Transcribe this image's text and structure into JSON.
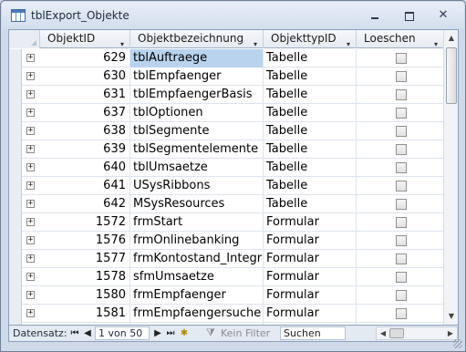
{
  "window": {
    "title": "tblExport_Objekte",
    "buttons": {
      "minimize": "",
      "maximize": "",
      "close": "✕"
    }
  },
  "columns": {
    "objektid": "ObjektID",
    "bezeichnung": "Objektbezeichnung",
    "typ": "ObjekttypID",
    "loeschen": "Loeschen",
    "sort_arrow": "▾"
  },
  "rows": [
    {
      "id": "629",
      "name": "tblAuftraege",
      "type": "Tabelle",
      "loeschen": false
    },
    {
      "id": "630",
      "name": "tblEmpfaenger",
      "type": "Tabelle",
      "loeschen": false
    },
    {
      "id": "631",
      "name": "tblEmpfaengerBasis",
      "type": "Tabelle",
      "loeschen": false
    },
    {
      "id": "637",
      "name": "tblOptionen",
      "type": "Tabelle",
      "loeschen": false
    },
    {
      "id": "638",
      "name": "tblSegmente",
      "type": "Tabelle",
      "loeschen": false
    },
    {
      "id": "639",
      "name": "tblSegmentelemente",
      "type": "Tabelle",
      "loeschen": false
    },
    {
      "id": "640",
      "name": "tblUmsaetze",
      "type": "Tabelle",
      "loeschen": false
    },
    {
      "id": "641",
      "name": "USysRibbons",
      "type": "Tabelle",
      "loeschen": false
    },
    {
      "id": "642",
      "name": "MSysResources",
      "type": "Tabelle",
      "loeschen": false
    },
    {
      "id": "1572",
      "name": "frmStart",
      "type": "Formular",
      "loeschen": false
    },
    {
      "id": "1576",
      "name": "frmOnlinebanking",
      "type": "Formular",
      "loeschen": false
    },
    {
      "id": "1577",
      "name": "frmKontostand_Integrie",
      "type": "Formular",
      "loeschen": false
    },
    {
      "id": "1578",
      "name": "sfmUmsaetze",
      "type": "Formular",
      "loeschen": false
    },
    {
      "id": "1580",
      "name": "frmEmpfaenger",
      "type": "Formular",
      "loeschen": false
    },
    {
      "id": "1581",
      "name": "frmEmpfaengersuche",
      "type": "Formular",
      "loeschen": false
    },
    {
      "id": "",
      "name": "",
      "type": "",
      "loeschen": false
    }
  ],
  "expander_glyph": "+",
  "navigation": {
    "label": "Datensatz:",
    "first": "⏮",
    "prev": "◀",
    "record": "1 von 50",
    "next": "▶",
    "last": "⏭",
    "new": "✱",
    "filter_icon": "⧩",
    "filter_text": "Kein Filter",
    "search": "Suchen"
  },
  "scroll": {
    "up": "▲",
    "down": "▼",
    "left": "◀",
    "right": "▶"
  },
  "active_row_index": 0
}
